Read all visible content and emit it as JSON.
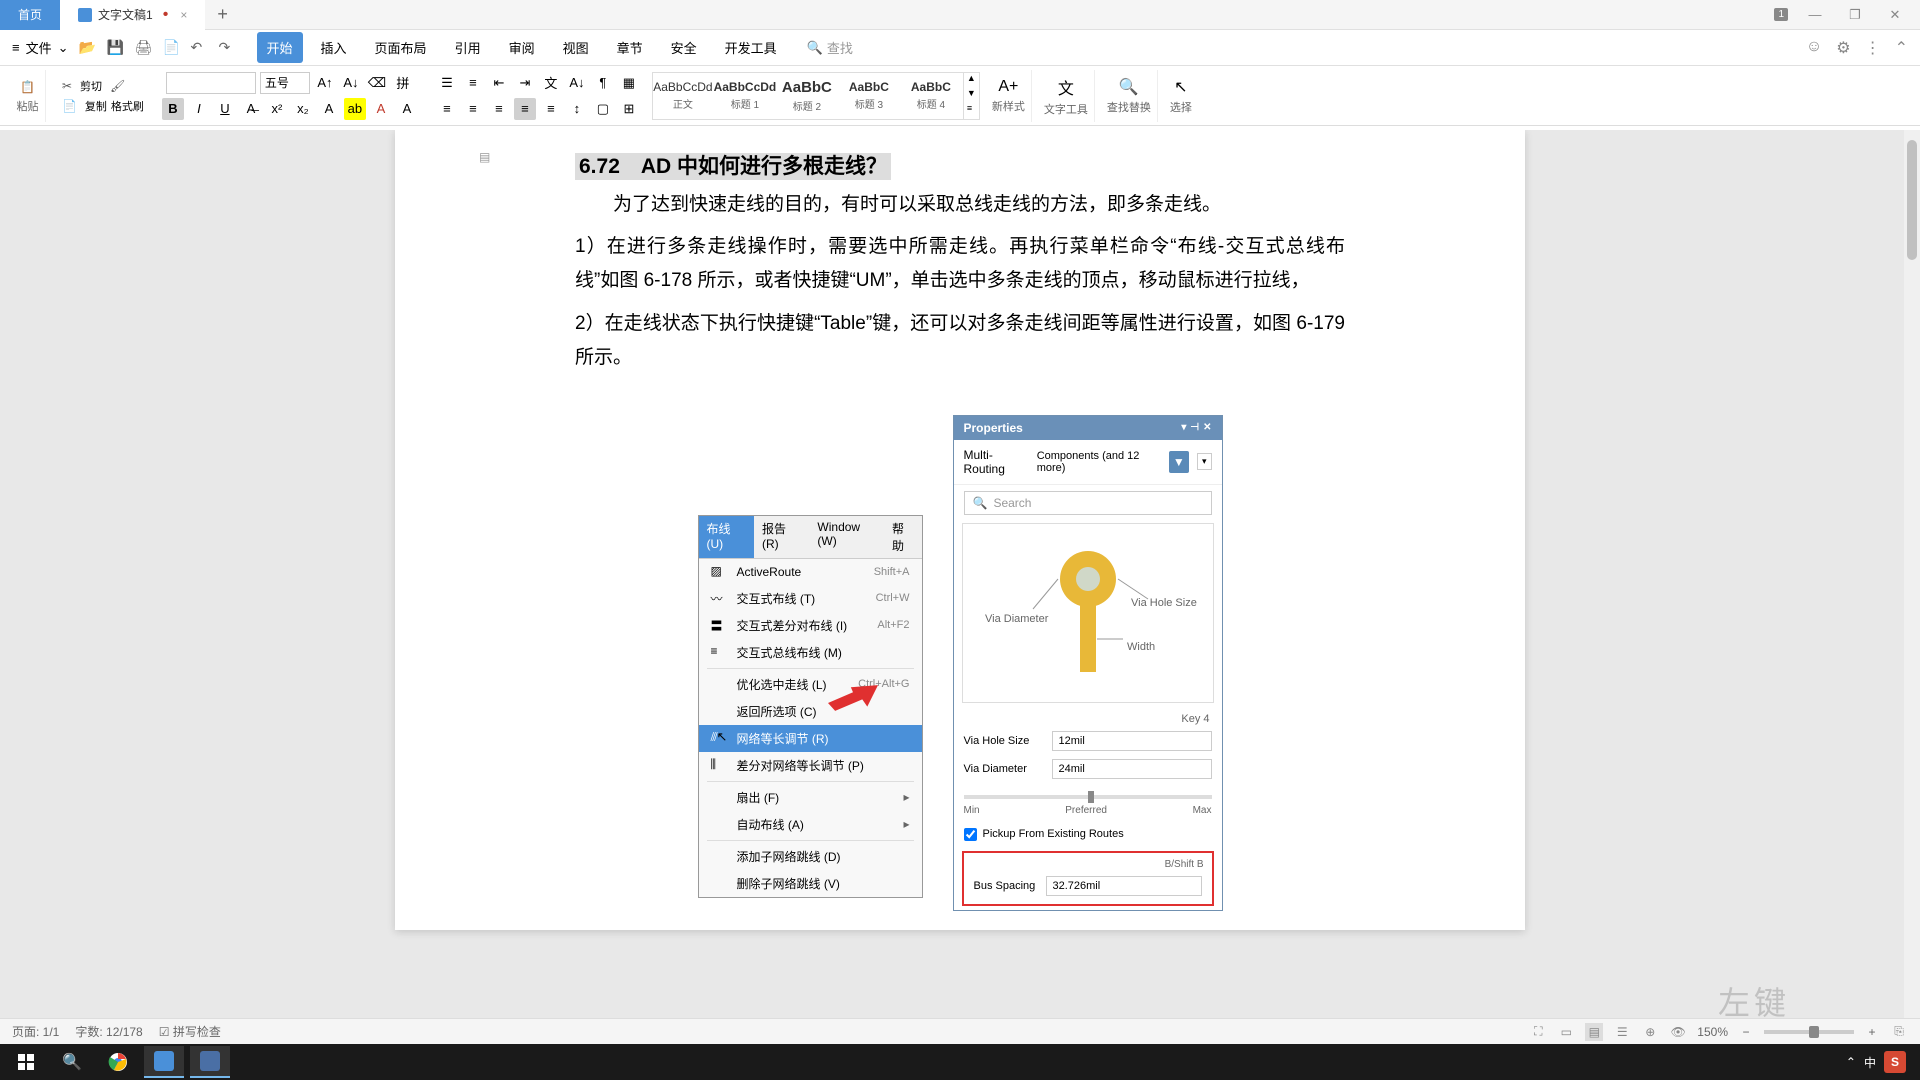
{
  "titleBar": {
    "homeTab": "首页",
    "docTab": "文字文稿1",
    "badge": "1"
  },
  "fileMenu": "文件",
  "menuTabs": {
    "start": "开始",
    "insert": "插入",
    "pageLayout": "页面布局",
    "reference": "引用",
    "review": "审阅",
    "view": "视图",
    "chapter": "章节",
    "security": "安全",
    "devTools": "开发工具"
  },
  "searchPlaceholder": "查找",
  "ribbon": {
    "paste": "粘贴",
    "copy": "复制",
    "formatPainter": "格式刷",
    "cut": "剪切",
    "fontSize": "五号",
    "styleNormal": "正文",
    "styleH1": "标题 1",
    "styleH2": "标题 2",
    "styleH3": "标题 3",
    "styleH4": "标题 4",
    "stylePreview": "AaBbCcDd",
    "stylePreviewH": "AaBbC",
    "newStyle": "新样式",
    "textTools": "文字工具",
    "findReplace": "查找替换",
    "select": "选择"
  },
  "document": {
    "heading": "6.72　AD 中如何进行多根走线？",
    "para1": "为了达到快速走线的目的，有时可以采取总线走线的方法，即多条走线。",
    "para2a": "1）在进行多条走线操作时，需要选中所需走线。再执行菜单栏命令“布线-交互式总线布线”如图 6-178 所示，或者快捷键“UM”，单击选中多条走线的顶点，移动鼠标进行拉线，",
    "para2b": "2）在走线状态下执行快捷键“Table”键，还可以对多条走线间距等属性进行设置，如图 6-179 所示。"
  },
  "menuShot": {
    "tabs": {
      "route": "布线 (U)",
      "report": "报告 (R)",
      "window": "Window (W)",
      "help": "帮助"
    },
    "items": {
      "activeRoute": "ActiveRoute",
      "activeRouteKey": "Shift+A",
      "interactive": "交互式布线 (T)",
      "interactiveKey": "Ctrl+W",
      "diffPair": "交互式差分对布线 (I)",
      "diffPairKey": "Alt+F2",
      "busRoute": "交互式总线布线 (M)",
      "optimize": "优化选中走线 (L)",
      "optimizeKey": "Ctrl+Alt+G",
      "returnSel": "返回所选项 (C)",
      "netTune": "网络等长调节 (R)",
      "diffTune": "差分对网络等长调节 (P)",
      "fanout": "扇出 (F)",
      "autoRoute": "自动布线 (A)",
      "addSubnet": "添加子网络跳线 (D)",
      "delSubnet": "删除子网络跳线 (V)"
    }
  },
  "props": {
    "title": "Properties",
    "mode": "Multi-Routing",
    "filterLabel": "Components (and 12 more)",
    "searchPlaceholder": "Search",
    "viaDiameterLabel": "Via Diameter",
    "viaHoleSizeLabel": "Via Hole Size",
    "widthLabel": "Width",
    "key4": "Key 4",
    "viaHoleSizeVal": "12mil",
    "viaDiameterVal": "24mil",
    "min": "Min",
    "preferred": "Preferred",
    "max": "Max",
    "pickup": "Pickup From Existing Routes",
    "bshift": "B/Shift B",
    "busSpacing": "Bus Spacing",
    "busSpacingVal": "32.726mil"
  },
  "statusBar": {
    "page": "页面: 1/1",
    "words": "字数: 12/178",
    "spellCheck": "拼写检查",
    "zoom": "150%"
  },
  "watermark": "左键",
  "taskbar": {
    "ime": "中"
  }
}
